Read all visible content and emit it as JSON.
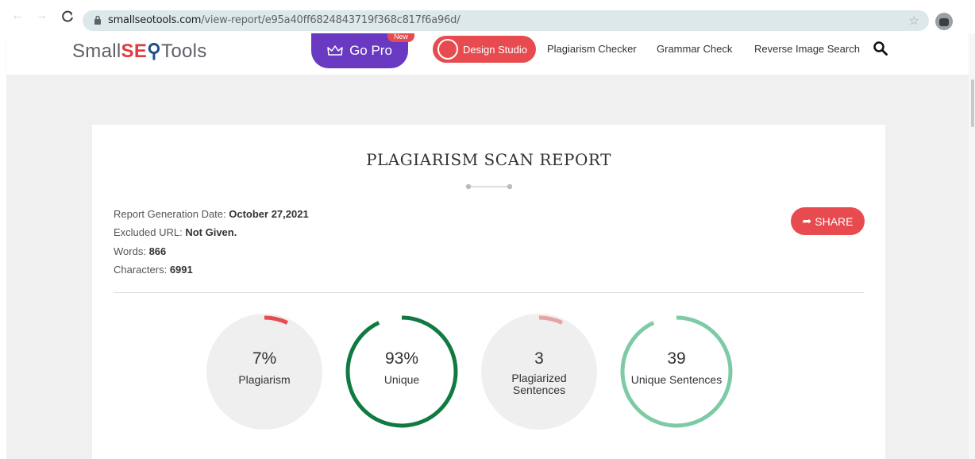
{
  "browser": {
    "url_host": "smallseotools.com",
    "url_path": "/view-report/e95a40ff6824843719f368c817f6a96d/"
  },
  "header": {
    "logo_prefix": "Small",
    "logo_s": "S",
    "logo_eq": "E",
    "logo_suffix": "Tools",
    "go_pro_label": "Go Pro",
    "new_badge": "New",
    "design_studio_label": "Design Studio",
    "nav": [
      "Plagiarism Checker",
      "Grammar Check",
      "Reverse Image Search"
    ]
  },
  "report": {
    "title": "PLAGIARISM SCAN REPORT",
    "meta": [
      {
        "label": "Report Generation Date: ",
        "value": "October 27,2021"
      },
      {
        "label": "Excluded URL: ",
        "value": "Not Given."
      },
      {
        "label": "Words: ",
        "value": "866"
      },
      {
        "label": "Characters: ",
        "value": "6991"
      }
    ],
    "share_label": "SHARE",
    "stats": [
      {
        "value": "7%",
        "label": "Plagiarism",
        "fraction": 0.07,
        "color": "#e84b4f"
      },
      {
        "value": "93%",
        "label": "Unique",
        "fraction": 0.93,
        "color": "#117a41"
      },
      {
        "value": "3",
        "label": "Plagiarized Sentences",
        "fraction": 0.07,
        "color": "#e8a3a3"
      },
      {
        "value": "39",
        "label": "Unique Sentences",
        "fraction": 0.93,
        "color": "#7dcba5"
      }
    ]
  }
}
